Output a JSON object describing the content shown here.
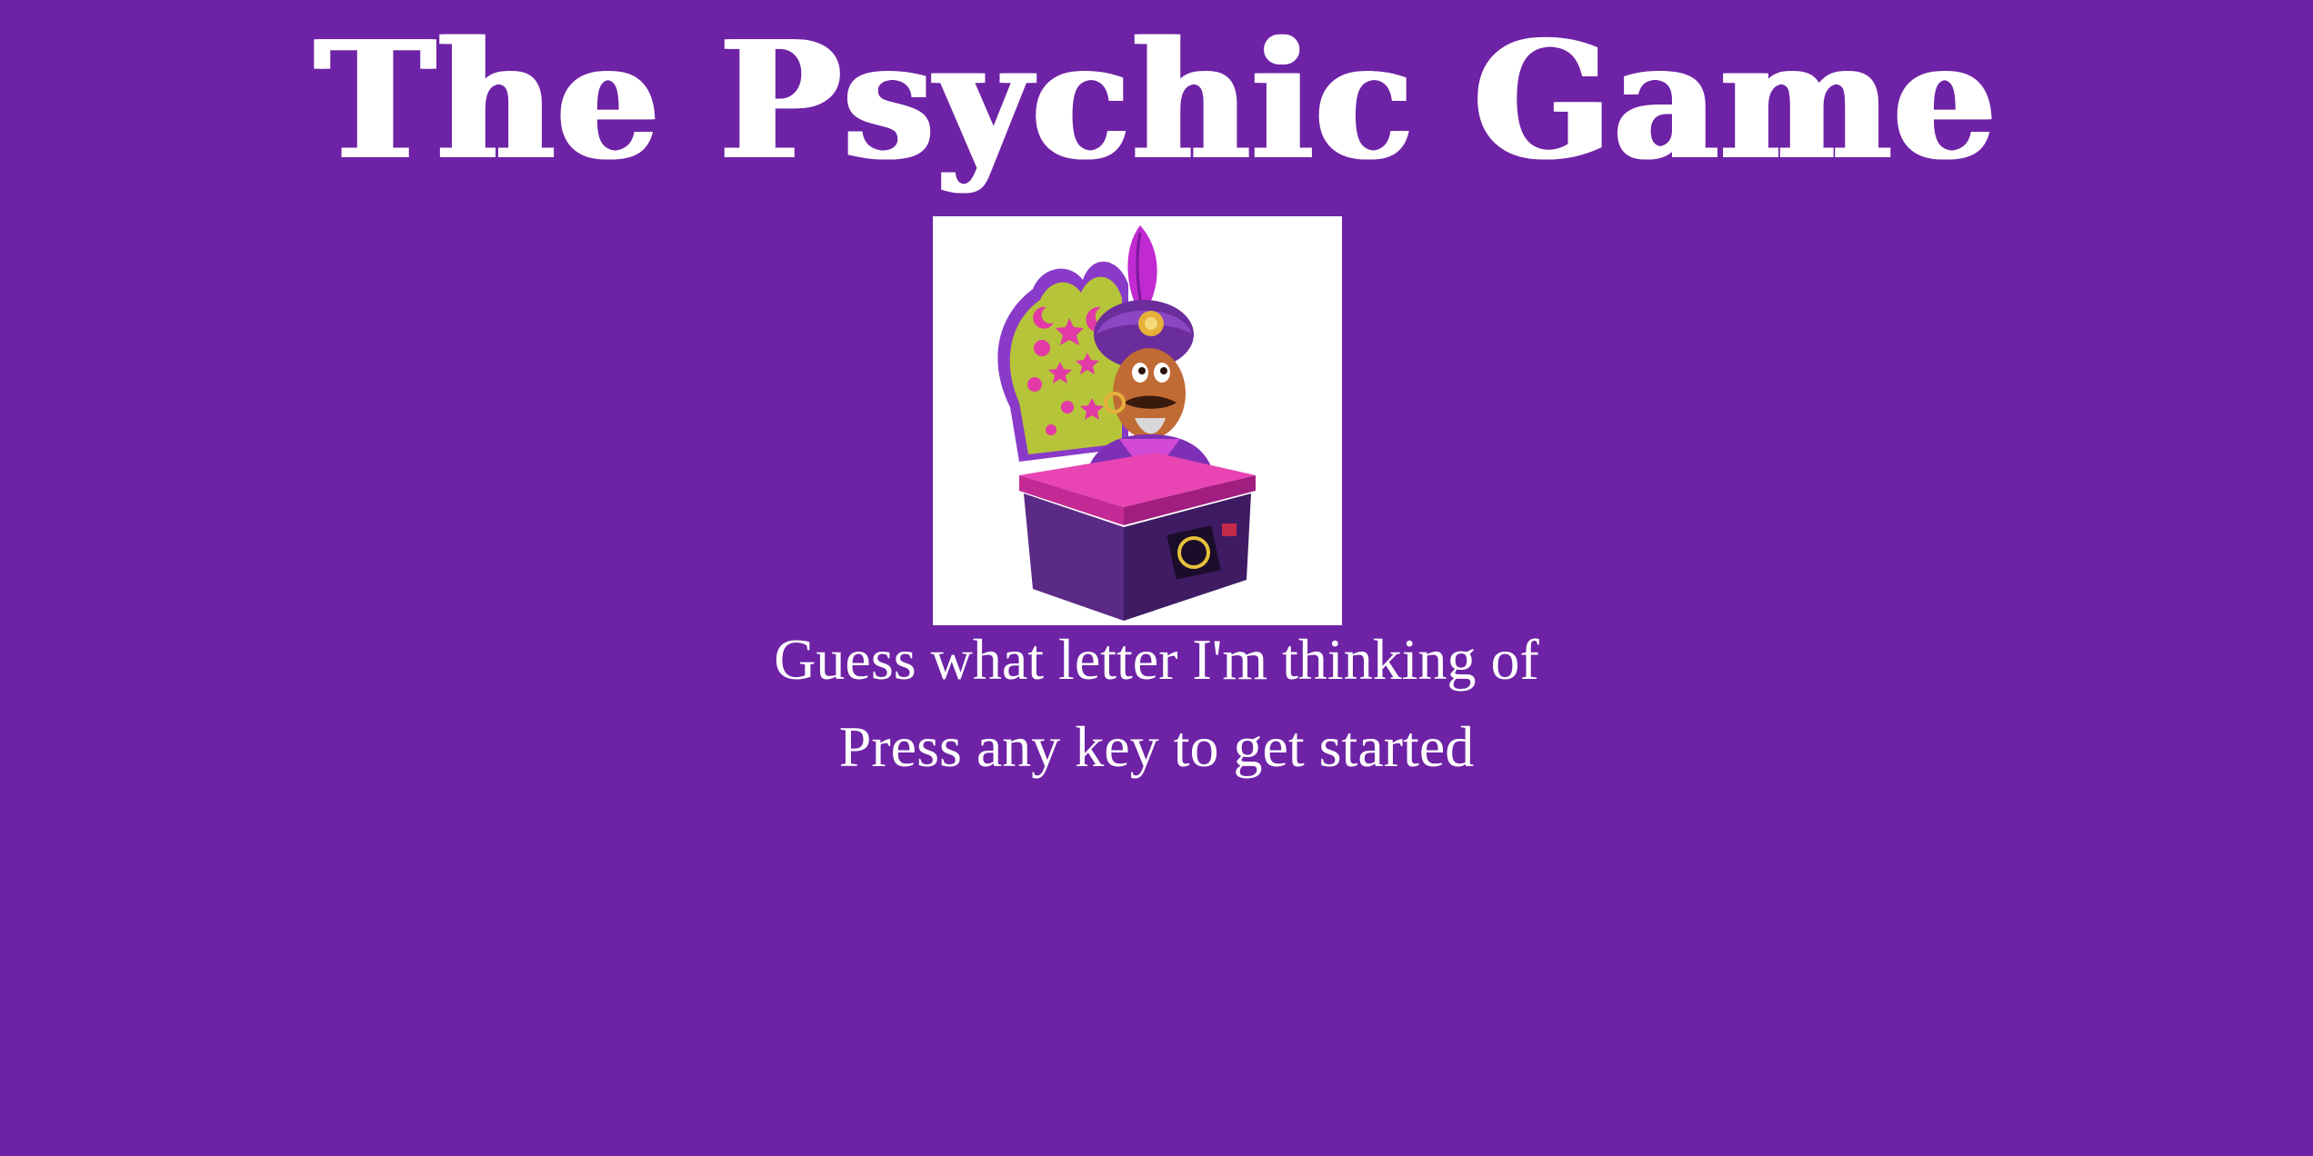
{
  "page": {
    "background": "#6e22a5",
    "text_color": "#ffffff"
  },
  "game": {
    "title": "The Psychic Game",
    "image_icon": "fortune-teller-machine-icon",
    "instruction": "Guess what letter I'm thinking of",
    "prompt": "Press any key to get started"
  }
}
